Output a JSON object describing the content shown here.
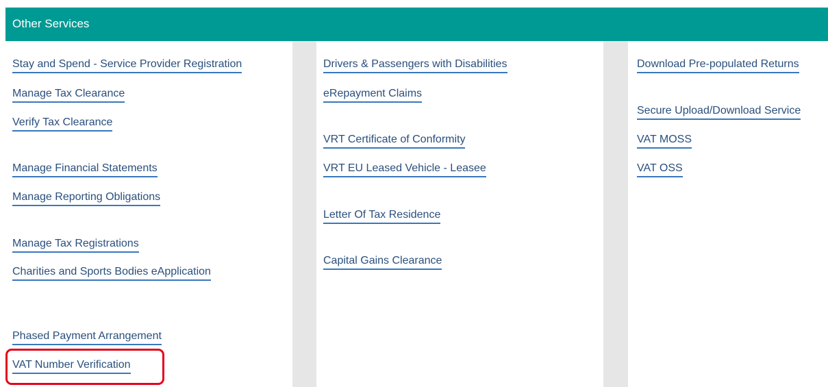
{
  "section": {
    "title": "Other Services"
  },
  "columns": [
    {
      "links": [
        "Stay and Spend - Service Provider Registration",
        "Manage Tax Clearance",
        "Verify Tax Clearance",
        "Manage Financial Statements",
        "Manage Reporting Obligations",
        "Manage Tax Registrations",
        "Charities and Sports Bodies eApplication",
        "Phased Payment Arrangement",
        "VAT Number Verification"
      ]
    },
    {
      "links": [
        "Drivers & Passengers with Disabilities",
        "eRepayment Claims",
        "VRT Certificate of Conformity",
        "VRT EU Leased Vehicle - Leasee",
        "Letter Of Tax Residence",
        "Capital Gains Clearance"
      ]
    },
    {
      "links": [
        "Download Pre-populated Returns",
        "Secure Upload/Download Service",
        "VAT MOSS",
        "VAT OSS"
      ]
    }
  ],
  "highlighted_link": "VAT Number Verification",
  "colors": {
    "header": "#009a94",
    "link_text": "#2a4f7d",
    "link_underline": "#3877be",
    "gutter": "#e6e6e6",
    "highlight": "#e3051b"
  }
}
